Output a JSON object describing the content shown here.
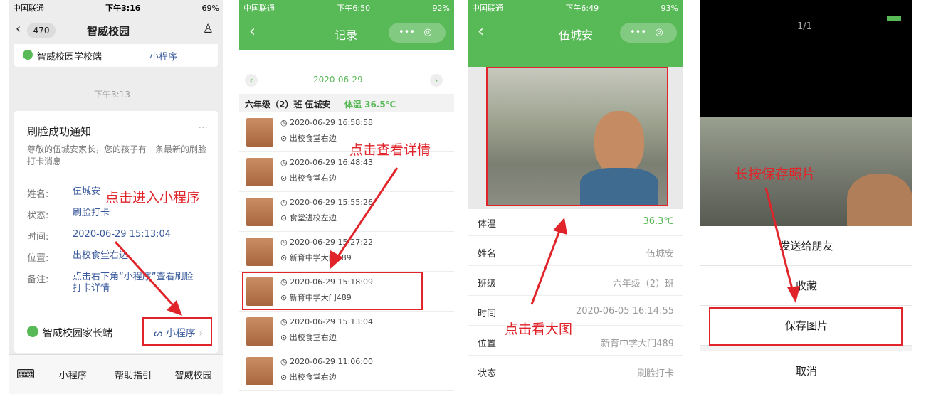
{
  "panel1": {
    "status": {
      "carrier": "中国联通",
      "time": "下午3:16",
      "battery": "69%"
    },
    "header": {
      "back_count": "470",
      "title": "智威校园"
    },
    "prev_source": "智威校园学校端",
    "prev_mini": "小程序",
    "timestamp": "下午3:13",
    "card": {
      "title": "刷脸成功通知",
      "desc": "尊敬的伍城安家长，您的孩子有一条最新的刷脸打卡消息",
      "fields": [
        {
          "k": "姓名:",
          "v": "伍城安"
        },
        {
          "k": "状态:",
          "v": "刷脸打卡"
        },
        {
          "k": "时间:",
          "v": "2020-06-29 15:13:04"
        },
        {
          "k": "位置:",
          "v": "出校食堂右边"
        },
        {
          "k": "备注:",
          "v": "点击右下角“小程序”查看刷脸打卡详情"
        }
      ],
      "source": "智威校园家长端",
      "mini": "小程序"
    },
    "annotation": "点击进入小程序",
    "bottom_menu": [
      "小程序",
      "帮助指引",
      "智威校园"
    ]
  },
  "panel2": {
    "status": {
      "carrier": "中国联通",
      "time": "下午6:50",
      "battery": "92%"
    },
    "title": "记录",
    "date": "2020-06-29",
    "student": "六年级（2）班 伍城安",
    "temp": "体温 36.5℃",
    "annotation": "点击查看详情",
    "records": [
      {
        "time": "2020-06-29 16:58:58",
        "loc": "出校食堂右边"
      },
      {
        "time": "2020-06-29 16:48:43",
        "loc": "出校食堂右边"
      },
      {
        "time": "2020-06-29 15:55:26",
        "loc": "食堂进校左边"
      },
      {
        "time": "2020-06-29 15:27:22",
        "loc": "新育中学大门489"
      },
      {
        "time": "2020-06-29 15:18:09",
        "loc": "新育中学大门489"
      },
      {
        "time": "2020-06-29 15:13:04",
        "loc": "出校食堂右边"
      },
      {
        "time": "2020-06-29 11:06:00",
        "loc": "出校食堂右边"
      }
    ]
  },
  "panel3": {
    "status": {
      "carrier": "中国联通",
      "time": "下午6:49",
      "battery": "93%"
    },
    "title": "伍城安",
    "rows": [
      {
        "k": "体温",
        "v": "36.3℃"
      },
      {
        "k": "姓名",
        "v": "伍城安"
      },
      {
        "k": "班级",
        "v": "六年级（2）班"
      },
      {
        "k": "时间",
        "v": "2020-06-05 16:14:55"
      },
      {
        "k": "位置",
        "v": "新育中学大门489"
      },
      {
        "k": "状态",
        "v": "刷脸打卡"
      }
    ],
    "annotation": "点击看大图"
  },
  "panel4": {
    "counter": "1/1",
    "annotation": "长按保存照片",
    "menu": [
      "发送给朋友",
      "收藏",
      "保存图片",
      "取消"
    ]
  },
  "colors": {
    "accent": "#58b957",
    "annotation": "#e0242a",
    "link": "#3a5a9c"
  }
}
